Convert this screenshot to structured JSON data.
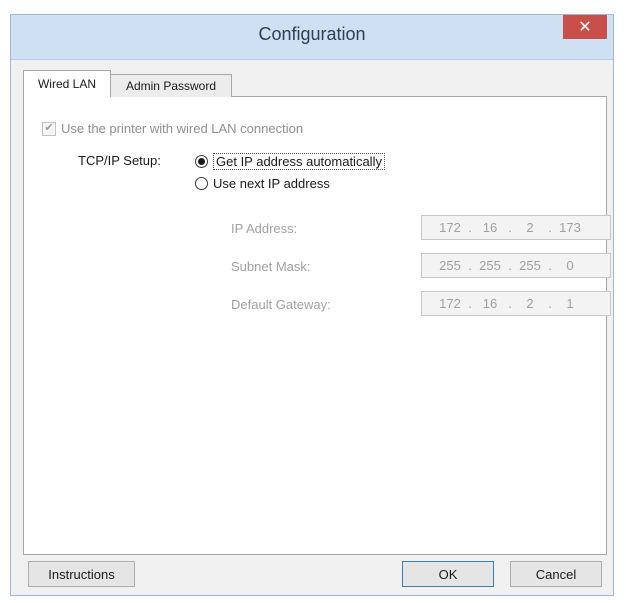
{
  "window": {
    "title": "Configuration",
    "close_symbol": "✕"
  },
  "tabs": [
    {
      "label": "Wired LAN",
      "active": true
    },
    {
      "label": "Admin Password",
      "active": false
    }
  ],
  "wired_lan": {
    "use_printer_checkbox": {
      "label": "Use the printer with wired LAN connection",
      "checked": true,
      "enabled": false
    },
    "tcpip_setup_label": "TCP/IP Setup:",
    "radio_options": [
      {
        "label": "Get IP address automatically",
        "selected": true
      },
      {
        "label": "Use next IP address",
        "selected": false
      }
    ],
    "fields": [
      {
        "label": "IP Address:",
        "octets": [
          "172",
          "16",
          "2",
          "173"
        ]
      },
      {
        "label": "Subnet Mask:",
        "octets": [
          "255",
          "255",
          "255",
          "0"
        ]
      },
      {
        "label": "Default Gateway:",
        "octets": [
          "172",
          "16",
          "2",
          "1"
        ]
      }
    ]
  },
  "buttons": {
    "instructions": "Instructions",
    "ok": "OK",
    "cancel": "Cancel"
  },
  "colors": {
    "close_button": "#c9504a",
    "titlebar": "#cfe0f2",
    "dialog_background": "#f0f0f0"
  }
}
